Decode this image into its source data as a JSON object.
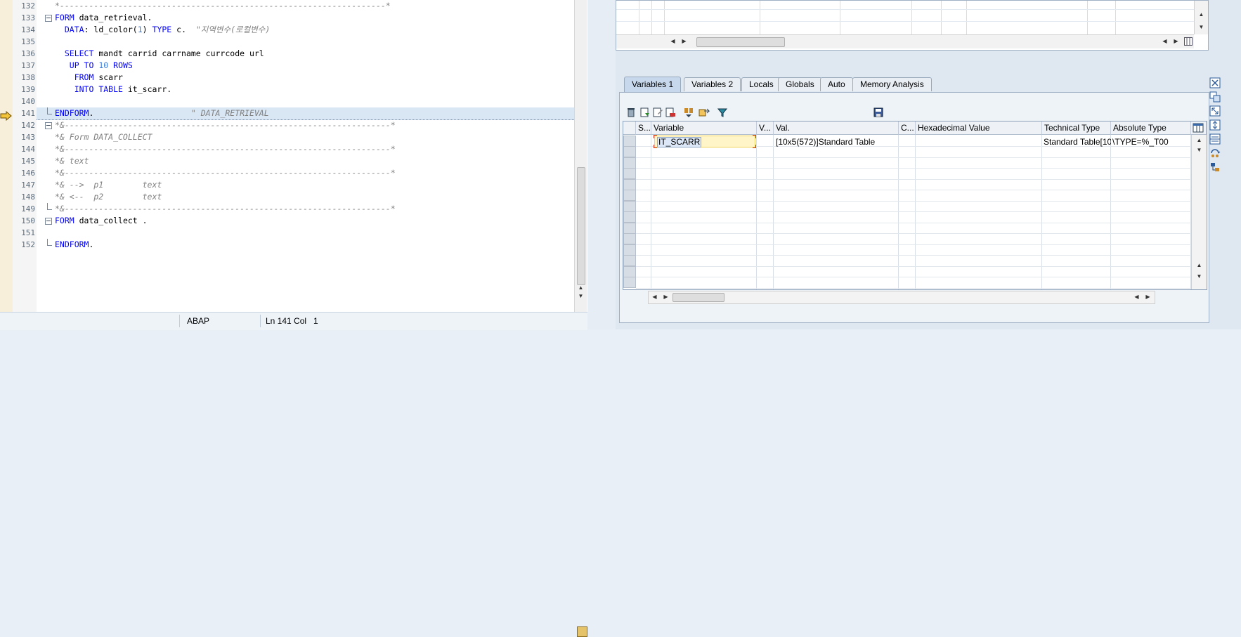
{
  "editor": {
    "lines": [
      {
        "n": "132",
        "text": "*-------------------------------------------------------------------*",
        "kind": "comment"
      },
      {
        "n": "133",
        "kw": "FORM",
        "rest": " data_retrieval.",
        "fold": "open"
      },
      {
        "n": "134",
        "pre": "  ",
        "kw": "DATA",
        "rest": ": ld_color(",
        "num": "1",
        "rest2": ") ",
        "kw2": "TYPE",
        "rest3": " c.  ",
        "cm": "\"지역변수(로컬변수)"
      },
      {
        "n": "135",
        "text": ""
      },
      {
        "n": "136",
        "pre": "  ",
        "kw": "SELECT",
        "rest": " mandt carrid carrname currcode url"
      },
      {
        "n": "137",
        "pre": "   ",
        "kw": "UP TO",
        "rest": " ",
        "num": "10",
        "rest2": " ",
        "kw2": "ROWS"
      },
      {
        "n": "138",
        "pre": "    ",
        "kw": "FROM",
        "rest": " scarr"
      },
      {
        "n": "139",
        "pre": "    ",
        "kw": "INTO TABLE",
        "rest": " it_scarr."
      },
      {
        "n": "140",
        "text": ""
      },
      {
        "n": "141",
        "kw": "ENDFORM",
        "rest": ".                    ",
        "cm": "\" DATA_RETRIEVAL",
        "fold": "end",
        "current": true
      },
      {
        "n": "142",
        "text": "*&-------------------------------------------------------------------*",
        "kind": "comment",
        "fold": "open"
      },
      {
        "n": "143",
        "text": "*& Form DATA_COLLECT",
        "kind": "comment"
      },
      {
        "n": "144",
        "text": "*&-------------------------------------------------------------------*",
        "kind": "comment"
      },
      {
        "n": "145",
        "text": "*& text",
        "kind": "comment"
      },
      {
        "n": "146",
        "text": "*&-------------------------------------------------------------------*",
        "kind": "comment"
      },
      {
        "n": "147",
        "text": "*& -->  p1        text",
        "kind": "comment"
      },
      {
        "n": "148",
        "text": "*& <--  p2        text",
        "kind": "comment"
      },
      {
        "n": "149",
        "text": "*&-------------------------------------------------------------------*",
        "kind": "comment",
        "fold": "end"
      },
      {
        "n": "150",
        "kw": "FORM",
        "rest": " data_collect .",
        "fold": "open"
      },
      {
        "n": "151",
        "text": ""
      },
      {
        "n": "152",
        "kw": "ENDFORM",
        "rest": ".",
        "fold": "end"
      }
    ],
    "status": {
      "language": "ABAP",
      "position": "Ln 141 Col   1"
    }
  },
  "tabs": [
    {
      "label": "Variables 1",
      "active": true
    },
    {
      "label": "Variables 2"
    },
    {
      "label": "Locals"
    },
    {
      "label": "Globals"
    },
    {
      "label": "Auto"
    },
    {
      "label": "Memory Analysis"
    }
  ],
  "grid": {
    "columns": [
      "S...",
      "Variable",
      "V...",
      "Val.",
      "C...",
      "Hexadecimal Value",
      "Technical Type",
      "Absolute Type"
    ],
    "row": {
      "variable": "IT_SCARR",
      "value": "[10x5(572)]Standard Table",
      "technical": "Standard Table[10...",
      "absolute": "\\TYPE=%_T00"
    }
  },
  "toolbar_icons": [
    "delete-icon",
    "display-icon",
    "edit-icon",
    "insert-icon",
    "download-icon",
    "export-icon",
    "filter-icon",
    "save-icon"
  ],
  "side_icons": [
    "close-panel-icon",
    "layout-icon",
    "maximize-icon",
    "split-icon",
    "columns-icon",
    "refresh-icon",
    "settings-icon"
  ],
  "colors": {
    "keyword": "#0000ff",
    "comment": "#808080",
    "number": "#3a7bd5",
    "accent": "#c7d8ec"
  }
}
